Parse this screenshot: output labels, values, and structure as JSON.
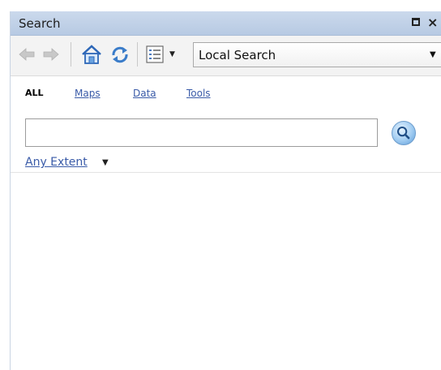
{
  "window": {
    "title": "Search",
    "close_glyph": "×"
  },
  "toolbar": {
    "location_value": "Local Search"
  },
  "filters": {
    "tabs": [
      "ALL",
      "Maps",
      "Data",
      "Tools"
    ],
    "active_tab": "ALL"
  },
  "search": {
    "value": "",
    "placeholder": ""
  },
  "extent": {
    "label": "Any Extent"
  },
  "icons": {
    "back": "back-arrow-icon",
    "forward": "forward-arrow-icon",
    "home": "home-icon",
    "refresh": "refresh-icon",
    "list": "list-view-icon",
    "search": "magnifier-icon",
    "maximize": "maximize-icon",
    "close": "close-icon"
  },
  "colors": {
    "title_bar": "#b7cae3",
    "link": "#3a5ba8",
    "search_button": "#9fcbf1"
  }
}
